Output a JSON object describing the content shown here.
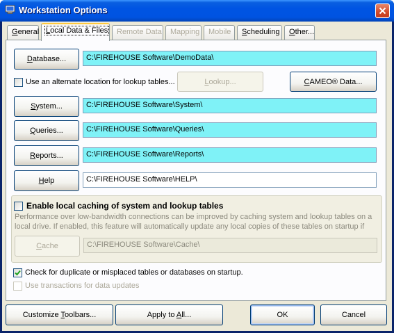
{
  "window": {
    "title": "Workstation Options"
  },
  "tabs": [
    {
      "label": "General",
      "access": "G",
      "rest": "eneral",
      "prefix": "",
      "state": "normal"
    },
    {
      "label": "Local Data & Files",
      "access": "L",
      "rest": "ocal Data & Files",
      "prefix": "",
      "state": "active"
    },
    {
      "label": "Remote Data",
      "access": "",
      "rest": "Remote Data",
      "prefix": "",
      "state": "disabled"
    },
    {
      "label": "Mapping",
      "access": "",
      "rest": "Mapping",
      "prefix": "",
      "state": "disabled"
    },
    {
      "label": "Mobile",
      "access": "",
      "rest": "Mobile",
      "prefix": "",
      "state": "disabled"
    },
    {
      "label": "Scheduling",
      "access": "S",
      "rest": "cheduling",
      "prefix": "",
      "state": "normal"
    },
    {
      "label": "Other...",
      "access": "O",
      "rest": "ther...",
      "prefix": "",
      "state": "normal"
    }
  ],
  "paths": {
    "database": {
      "button": "Database...",
      "access": "D",
      "rest": "atabase...",
      "value": "C:\\FIREHOUSE Software\\DemoData\\"
    },
    "system": {
      "button": "System...",
      "access": "S",
      "rest": "ystem...",
      "value": "C:\\FIREHOUSE Software\\System\\"
    },
    "queries": {
      "button": "Queries...",
      "access": "Q",
      "rest": "ueries...",
      "value": "C:\\FIREHOUSE Software\\Queries\\"
    },
    "reports": {
      "button": "Reports...",
      "access": "R",
      "rest": "eports...",
      "value": "C:\\FIREHOUSE Software\\Reports\\"
    },
    "help": {
      "button": "Help",
      "access": "H",
      "rest": "elp",
      "value": "C:\\FIREHOUSE Software\\HELP\\"
    }
  },
  "alternate_lookup": {
    "label": "Use an alternate location for lookup tables...",
    "checked": false,
    "lookup_button": "Lookup...",
    "lookup_access": "L",
    "lookup_rest": "ookup...",
    "cameo_button": "CAMEO® Data...",
    "cameo_access": "C",
    "cameo_rest": "AMEO® Data..."
  },
  "caching": {
    "label": "Enable local caching of system and lookup tables",
    "checked": false,
    "note_line1": "Performance over low-bandwidth connections can be improved by caching system and lookup tables on a",
    "note_line2": "local drive. If enabled, this feature will automatically update any local copies of these tables on startup if",
    "cache_button": "Cache",
    "cache_access": "C",
    "cache_rest": "ache",
    "cache_path": "C:\\FIREHOUSE Software\\Cache\\"
  },
  "startup_check": {
    "label": "Check for duplicate or misplaced tables or databases on startup.",
    "checked": true
  },
  "transactions": {
    "label": "Use transactions for data updates",
    "checked": false
  },
  "footer": {
    "customize_prefix": "Customize ",
    "customize_access": "T",
    "customize_rest": "oolbars...",
    "apply_prefix": "Apply to ",
    "apply_access": "A",
    "apply_rest": "ll...",
    "ok": "OK",
    "cancel": "Cancel"
  }
}
